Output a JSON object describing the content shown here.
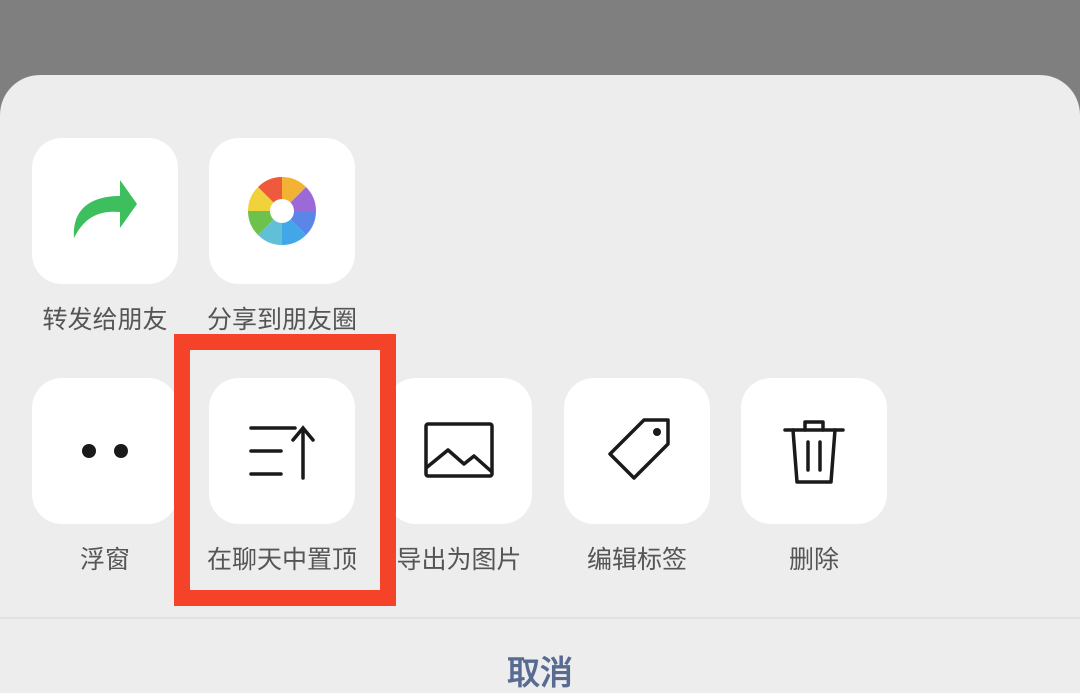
{
  "share_row": {
    "items": [
      {
        "label": "转发给朋友",
        "icon": "forward-arrow-icon",
        "color": "#3dbf5e"
      },
      {
        "label": "分享到朋友圈",
        "icon": "moments-shutter-icon"
      }
    ]
  },
  "action_row": {
    "items": [
      {
        "label": "浮窗",
        "icon": "float-window-icon"
      },
      {
        "label": "在聊天中置顶",
        "icon": "pin-to-top-icon",
        "highlighted": true
      },
      {
        "label": "导出为图片",
        "icon": "image-icon"
      },
      {
        "label": "编辑标签",
        "icon": "tag-icon"
      },
      {
        "label": "删除",
        "icon": "trash-icon"
      }
    ]
  },
  "cancel_label": "取消",
  "colors": {
    "backdrop": "#7f7f7f",
    "sheet": "#ededed",
    "tile": "#ffffff",
    "highlight": "#f5432a",
    "cancel_text": "#586c92"
  }
}
